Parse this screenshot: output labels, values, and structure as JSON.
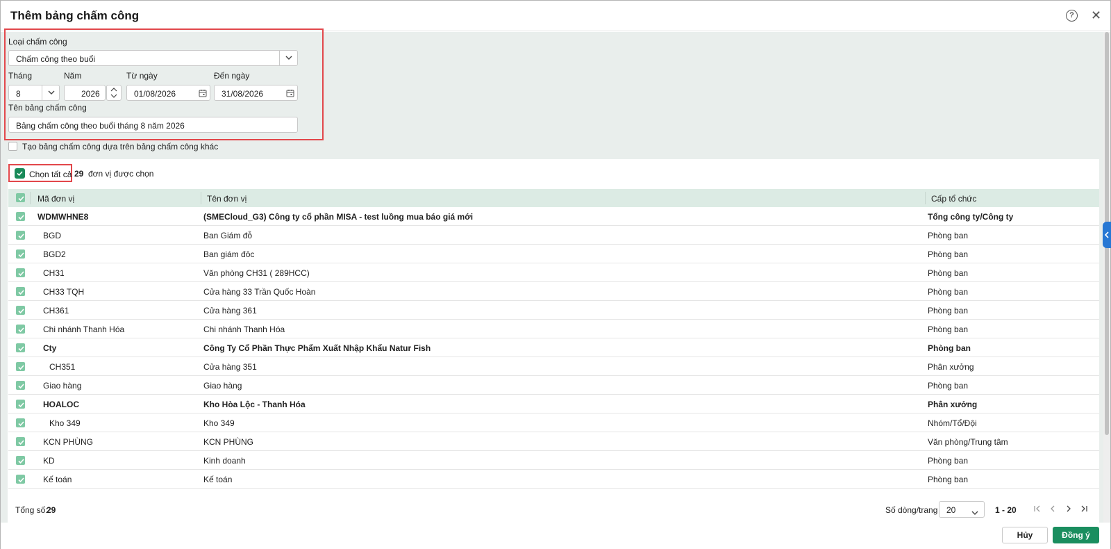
{
  "dialog": {
    "title": "Thêm bảng chấm công"
  },
  "form": {
    "type_label": "Loại chấm công",
    "type_value": "Chấm công theo buổi",
    "month_label": "Tháng",
    "month_value": "8",
    "year_label": "Năm",
    "year_value": "2026",
    "from_label": "Từ ngày",
    "from_value": "01/08/2026",
    "to_label": "Đến ngày",
    "to_value": "31/08/2026",
    "name_label": "Tên bảng chấm công",
    "name_value": "Bảng chấm công theo buổi tháng 8 năm 2026",
    "base_on_other_label": "Tạo bảng chấm công dựa trên bảng chấm công khác"
  },
  "selection": {
    "select_all_label": "Chọn tất cả",
    "count": "29",
    "count_suffix": "đơn vị được chọn"
  },
  "table": {
    "columns": [
      "Mã đơn vị",
      "Tên đơn vị",
      "Cấp tổ chức"
    ],
    "rows": [
      {
        "code": "WDMWHNE8",
        "name": "(SMECloud_G3) Công ty cổ phần MISA - test luồng mua báo giá mới",
        "level": "Tổng công ty/Công ty",
        "bold": true,
        "indent": 0
      },
      {
        "code": "BGD",
        "name": "Ban Giám đỗ",
        "level": "Phòng ban",
        "bold": false,
        "indent": 1
      },
      {
        "code": "BGD2",
        "name": "Ban giám đôc",
        "level": "Phòng ban",
        "bold": false,
        "indent": 1
      },
      {
        "code": "CH31",
        "name": "Văn phòng CH31 ( 289HCC)",
        "level": "Phòng ban",
        "bold": false,
        "indent": 1
      },
      {
        "code": "CH33 TQH",
        "name": "Cửa hàng 33 Trần Quốc Hoàn",
        "level": "Phòng ban",
        "bold": false,
        "indent": 1
      },
      {
        "code": "CH361",
        "name": "Cửa hàng 361",
        "level": "Phòng ban",
        "bold": false,
        "indent": 1
      },
      {
        "code": "Chi nhánh Thanh Hóa",
        "name": "Chi nhánh Thanh Hóa",
        "level": "Phòng ban",
        "bold": false,
        "indent": 1
      },
      {
        "code": "Cty",
        "name": "Công Ty Cổ Phần Thực Phẩm Xuất Nhập Khẩu Natur Fish",
        "level": "Phòng ban",
        "bold": true,
        "indent": 1
      },
      {
        "code": "CH351",
        "name": "Cửa hàng 351",
        "level": "Phân xưởng",
        "bold": false,
        "indent": 2
      },
      {
        "code": "Giao hàng",
        "name": "Giao hàng",
        "level": "Phòng ban",
        "bold": false,
        "indent": 1
      },
      {
        "code": "HOALOC",
        "name": "Kho Hòa Lộc - Thanh Hóa",
        "level": "Phân xưởng",
        "bold": true,
        "indent": 1
      },
      {
        "code": "Kho 349",
        "name": "Kho 349",
        "level": "Nhóm/Tổ/Đội",
        "bold": false,
        "indent": 2
      },
      {
        "code": "KCN PHÙNG",
        "name": "KCN PHÙNG",
        "level": "Văn phòng/Trung tâm",
        "bold": false,
        "indent": 1
      },
      {
        "code": "KD",
        "name": "Kinh doanh",
        "level": "Phòng ban",
        "bold": false,
        "indent": 1
      },
      {
        "code": "Kế toán",
        "name": "Kế toán",
        "level": "Phòng ban",
        "bold": false,
        "indent": 1
      }
    ]
  },
  "footer": {
    "total_label": "Tổng số:",
    "total_value": "29",
    "rows_per_page_label": "Số dòng/trang",
    "rows_per_page_value": "20",
    "range": "1 - 20"
  },
  "actions": {
    "cancel": "Hủy",
    "ok": "Đồng ý"
  },
  "colors": {
    "accent": "#1a8e5f",
    "highlight": "#e2474b",
    "header_bg": "#dcebe4",
    "content_bg": "#e9eeec",
    "side_tab": "#2778d4"
  }
}
